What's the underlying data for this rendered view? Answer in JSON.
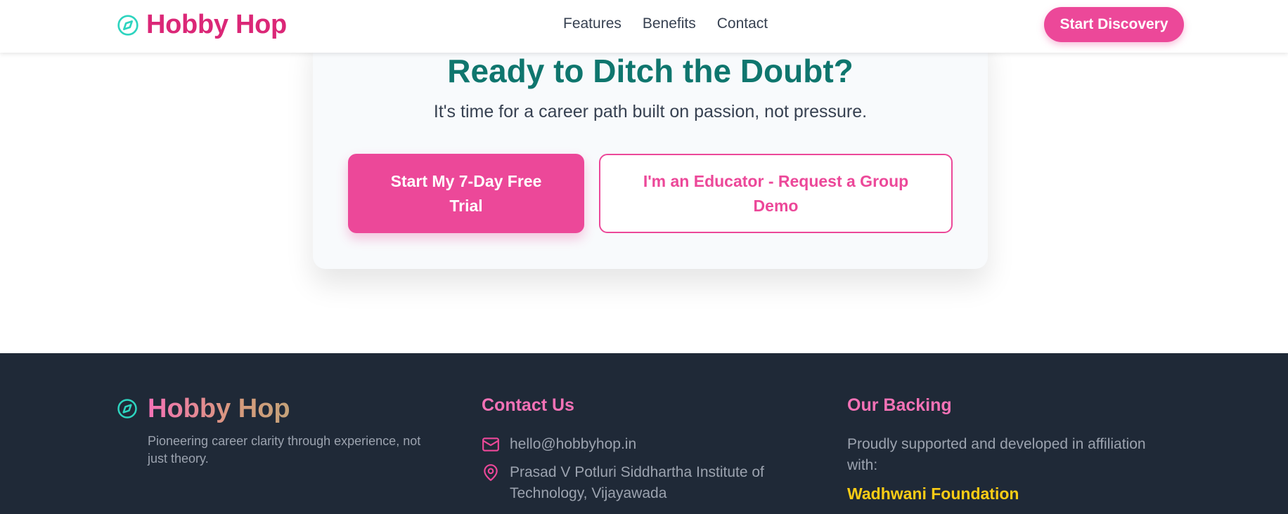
{
  "header": {
    "brand": "Hobby Hop",
    "nav": [
      "Features",
      "Benefits",
      "Contact"
    ],
    "cta": "Start Discovery"
  },
  "cta_card": {
    "title": "Ready to Ditch the Doubt?",
    "subtitle": "It's time for a career path built on passion, not pressure.",
    "primary_button": "Start My 7-Day Free Trial",
    "secondary_button": "I'm an Educator - Request a Group Demo"
  },
  "footer": {
    "brand": "Hobby Hop",
    "tagline": "Pioneering career clarity through experience, not just theory.",
    "contact": {
      "title": "Contact Us",
      "email": "hello@hobbyhop.in",
      "address": "Prasad V Potluri Siddhartha Institute of Technology, Vijayawada"
    },
    "backing": {
      "title": "Our Backing",
      "text": "Proudly supported and developed in affiliation with:",
      "name": "Wadhwani Foundation"
    }
  },
  "icons": {
    "logo": "compass-icon",
    "email": "mail-icon",
    "address": "map-pin-icon"
  },
  "colors": {
    "accent_pink": "#ec4899",
    "brand_pink": "#db2777",
    "teal_title": "#0f766e",
    "logo_teal": "#2dd4bf",
    "footer_bg": "#1f2937",
    "highlight_yellow": "#facc15"
  }
}
